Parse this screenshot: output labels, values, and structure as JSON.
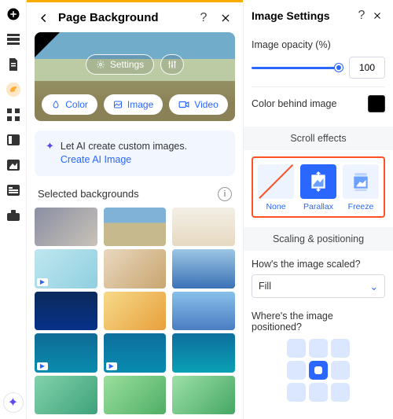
{
  "panel": {
    "title": "Page Background",
    "settings_label": "Settings",
    "buttons": {
      "color": "Color",
      "image": "Image",
      "video": "Video"
    }
  },
  "ai": {
    "line1": "Let AI create custom images.",
    "link": "Create AI Image"
  },
  "selected_label": "Selected backgrounds",
  "thumbs_css": [
    "linear-gradient(135deg,#8b8fa3,#c8c2b8)",
    "linear-gradient(#7fb2d6 0 40%,#c7b98e 40% 100%)",
    "linear-gradient(#f3efe6,#e7d9c1)",
    "linear-gradient(135deg,#bfe6ef,#8fd0e0)",
    "linear-gradient(135deg,#e9d8bf,#c9a56f)",
    "linear-gradient(180deg,#9cc6e4,#3b72b6)",
    "linear-gradient(180deg,#0b2a5b,#08318a)",
    "linear-gradient(135deg,#f6d98a,#e8a03b)",
    "linear-gradient(180deg,#88c0ea,#4a7dc2)",
    "linear-gradient(180deg,#0f6b96,#0a8cae)",
    "linear-gradient(180deg,#0e6f9d,#088bb0)",
    "linear-gradient(180deg,#0e6f9d,#0aa0b5)",
    "linear-gradient(135deg,#82d2ac,#3ea27a)",
    "linear-gradient(135deg,#9adf9c,#4fae66)",
    "linear-gradient(135deg,#9de0a8,#45a764)"
  ],
  "thumb_video_flags": [
    false,
    false,
    false,
    true,
    false,
    false,
    false,
    false,
    false,
    true,
    true,
    false,
    false,
    false,
    false
  ],
  "settings": {
    "title": "Image Settings",
    "opacity_label": "Image opacity (%)",
    "opacity_value": "100",
    "color_behind_label": "Color behind image",
    "scroll_title": "Scroll effects",
    "effects": {
      "none": "None",
      "parallax": "Parallax",
      "freeze": "Freeze"
    },
    "scaling_title": "Scaling & positioning",
    "scale_q": "How's the image scaled?",
    "scale_value": "Fill",
    "position_q": "Where's the image positioned?"
  }
}
